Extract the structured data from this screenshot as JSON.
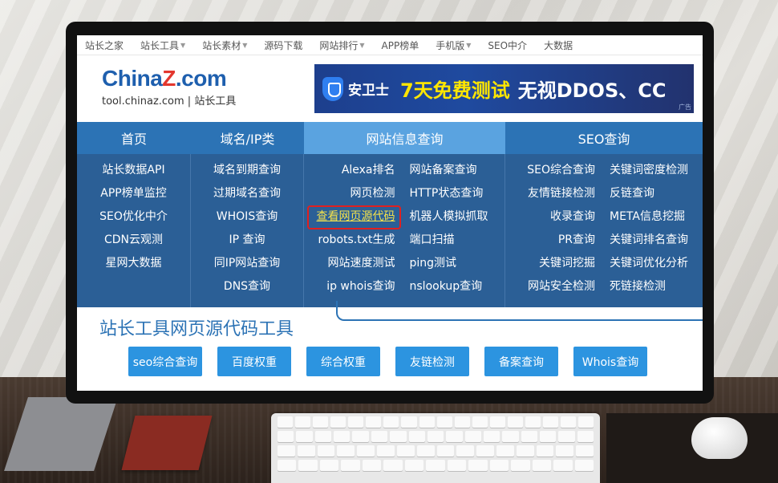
{
  "topnav": [
    {
      "label": "站长之家",
      "caret": false
    },
    {
      "label": "站长工具",
      "caret": true
    },
    {
      "label": "站长素材",
      "caret": true
    },
    {
      "label": "源码下载",
      "caret": false
    },
    {
      "label": "网站排行",
      "caret": true
    },
    {
      "label": "APP榜单",
      "caret": false
    },
    {
      "label": "手机版",
      "caret": true
    },
    {
      "label": "SEO中介",
      "caret": false
    },
    {
      "label": "大数据",
      "caret": false
    }
  ],
  "logo": {
    "brand_part1": "China",
    "brand_part2": "Z",
    "brand_part3": ".com",
    "subtitle": "tool.chinaz.com | 站长工具"
  },
  "banner": {
    "brand": "安卫士",
    "promo": "7天免费测试",
    "tagline": "无视DDOS、CC",
    "ad_label": "广告"
  },
  "menu": {
    "headers": [
      "首页",
      "域名/IP类",
      "网站信息查询",
      "SEO查询"
    ],
    "active_header": "网站信息查询",
    "col1": [
      "站长数据API",
      "APP榜单监控",
      "SEO优化中介",
      "CDN云观测",
      "星网大数据"
    ],
    "col2": [
      "域名到期查询",
      "过期域名查询",
      "WHOIS查询",
      "IP 查询",
      "同IP网站查询",
      "DNS查询"
    ],
    "col3_left": [
      "Alexa排名",
      "网页检测",
      "查看网页源代码",
      "robots.txt生成",
      "网站速度测试",
      "ip whois查询"
    ],
    "col3_right": [
      "网站备案查询",
      "HTTP状态查询",
      "机器人模拟抓取",
      "端口扫描",
      "ping测试",
      "nslookup查询"
    ],
    "col4_left": [
      "SEO综合查询",
      "友情链接检测",
      "收录查询",
      "PR查询",
      "关键词挖掘",
      "网站安全检测"
    ],
    "col4_right": [
      "关键词密度检测",
      "反链查询",
      "META信息挖掘",
      "关键词排名查询",
      "关键词优化分析",
      "死链接检测"
    ],
    "highlighted_item": "查看网页源代码"
  },
  "content": {
    "title": "站长工具网页源代码工具",
    "tools": [
      "seo综合查询",
      "百度权重",
      "综合权重",
      "友链检测",
      "备案查询",
      "Whois查询"
    ]
  },
  "colors": {
    "menu_blue": "#2c73b5",
    "menu_active": "#5aa3e0",
    "button_blue": "#2c94e0",
    "highlight_red": "#e02020",
    "highlight_text": "#f5e24a"
  }
}
